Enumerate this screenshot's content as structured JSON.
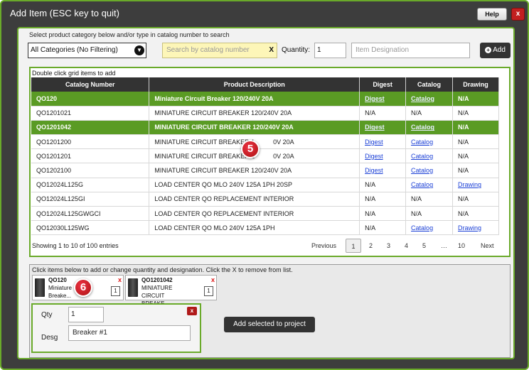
{
  "window": {
    "title": "Add Item (ESC key to quit)",
    "help_label": "Help",
    "close_label": "x"
  },
  "filters": {
    "instruction": "Select product category below and/or type in catalog number to search",
    "category_value": "All Categories (No Filtering)",
    "search_placeholder": "Search by catalog number",
    "search_clear": "X",
    "quantity_label": "Quantity:",
    "quantity_value": "1",
    "designation_placeholder": "Item Designation",
    "add_label": "Add"
  },
  "grid": {
    "hint": "Double click grid items to add",
    "columns": [
      "Catalog Number",
      "Product Description",
      "Digest",
      "Catalog",
      "Drawing"
    ],
    "rows": [
      {
        "cat": "QO120",
        "desc": "Miniature Circuit Breaker 120/240V 20A",
        "digest": "Digest",
        "catalog": "Catalog",
        "drawing": "N/A",
        "selected": true
      },
      {
        "cat": "QO1201021",
        "desc": "MINIATURE CIRCUIT BREAKER 120/240V 20A",
        "digest": "N/A",
        "catalog": "N/A",
        "drawing": "N/A",
        "selected": false
      },
      {
        "cat": "QO1201042",
        "desc": "MINIATURE CIRCUIT BREAKER 120/240V 20A",
        "digest": "Digest",
        "catalog": "Catalog",
        "drawing": "N/A",
        "selected": true
      },
      {
        "cat": "QO1201200",
        "desc": "MINIATURE CIRCUIT BREAKER 1",
        "desc_tail": "0V 20A",
        "digest": "Digest",
        "catalog": "Catalog",
        "drawing": "N/A",
        "selected": false
      },
      {
        "cat": "QO1201201",
        "desc": "MINIATURE CIRCUIT BREAKER 1",
        "desc_tail": "0V 20A",
        "digest": "Digest",
        "catalog": "Catalog",
        "drawing": "N/A",
        "selected": false
      },
      {
        "cat": "QO1202100",
        "desc": "MINIATURE CIRCUIT BREAKER 120/240V 20A",
        "digest": "Digest",
        "catalog": "Catalog",
        "drawing": "N/A",
        "selected": false
      },
      {
        "cat": "QO12024L125G",
        "desc": "LOAD CENTER QO MLO 240V 125A 1PH 20SP",
        "digest": "N/A",
        "catalog": "Catalog",
        "drawing": "Drawing",
        "selected": false
      },
      {
        "cat": "QO12024L125GI",
        "desc": "LOAD CENTER QO REPLACEMENT INTERIOR",
        "digest": "N/A",
        "catalog": "N/A",
        "drawing": "N/A",
        "selected": false
      },
      {
        "cat": "QO12024L125GWGCI",
        "desc": "LOAD CENTER QO REPLACEMENT INTERIOR",
        "digest": "N/A",
        "catalog": "N/A",
        "drawing": "N/A",
        "selected": false
      },
      {
        "cat": "QO12030L125WG",
        "desc": "LOAD CENTER QO MLO 240V 125A 1PH",
        "digest": "N/A",
        "catalog": "Catalog",
        "drawing": "Drawing",
        "selected": false
      }
    ],
    "footer": "Showing 1 to 10 of 100 entries",
    "pager": {
      "previous": "Previous",
      "pages": [
        "1",
        "2",
        "3",
        "4",
        "5",
        "…",
        "10"
      ],
      "next": "Next"
    }
  },
  "cart": {
    "hint": "Click items below to add or change quantity and designation. Click the X to remove from list.",
    "items": [
      {
        "cat": "QO120",
        "desc": "Miniature Breake...",
        "desc_line1": "Miniature",
        "desc_line2": "Breake...",
        "qty": "1"
      },
      {
        "cat": "QO1201042",
        "desc_line1": "MINIATURE CIRCUIT",
        "desc_line2": "BREAKE...",
        "qty": "1"
      }
    ],
    "editor": {
      "qty_label": "Qty",
      "qty_value": "1",
      "desg_label": "Desg",
      "desg_value": "Breaker #1",
      "remove": "x"
    },
    "add_project_label": "Add selected to project"
  },
  "callouts": {
    "five": "5",
    "six": "6"
  },
  "colors": {
    "accent": "#6aaa2a",
    "selected_row": "#5a9b24",
    "link": "#1a3fd6",
    "danger": "#c21f1f"
  }
}
